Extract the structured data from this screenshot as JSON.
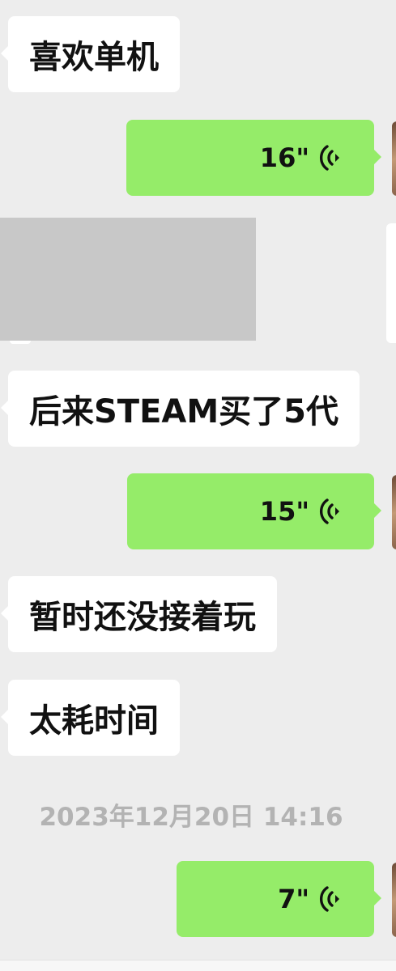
{
  "conversation": {
    "messages": [
      {
        "type": "text",
        "direction": "incoming",
        "text": "喜欢单机"
      },
      {
        "type": "voice",
        "direction": "outgoing",
        "duration": "16\""
      },
      {
        "type": "image",
        "direction": "incoming",
        "redacted": true
      },
      {
        "type": "text",
        "direction": "incoming",
        "text": "后来STEAM买了5代"
      },
      {
        "type": "voice",
        "direction": "outgoing",
        "duration": "15\""
      },
      {
        "type": "text",
        "direction": "incoming",
        "text": "暂时还没接着玩"
      },
      {
        "type": "text",
        "direction": "incoming",
        "text": "太耗时间"
      },
      {
        "type": "timestamp",
        "text": "2023年12月20日 14:16"
      },
      {
        "type": "voice",
        "direction": "outgoing",
        "duration": "7\""
      }
    ]
  },
  "colors": {
    "background": "#ededed",
    "incoming_bubble": "#ffffff",
    "outgoing_bubble": "#95ec69",
    "timestamp_text": "#b3b3b3"
  },
  "icons": {
    "voice": "voice-wave-icon"
  }
}
